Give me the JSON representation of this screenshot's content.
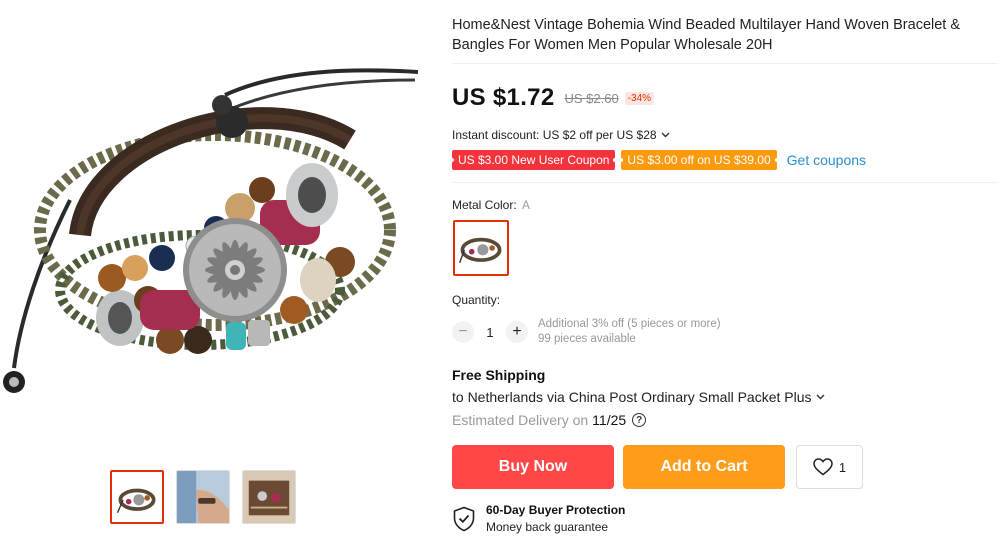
{
  "product": {
    "title": "Home&Nest Vintage Bohemia Wind Beaded Multilayer Hand Woven Bracelet & Bangles For Women Men Popular Wholesale 20H"
  },
  "price": {
    "current": "US $1.72",
    "original": "US $2.60",
    "discount": "-34%"
  },
  "discounts": {
    "instant": "Instant discount: US $2 off per US $28",
    "coupons": [
      "US $3.00 New User Coupon",
      "US $3.00 off on US $39.00"
    ],
    "get_coupons": "Get coupons"
  },
  "sku": {
    "label": "Metal Color:",
    "selected": "A"
  },
  "quantity": {
    "label": "Quantity:",
    "value": "1",
    "decrease": "−",
    "increase": "+",
    "note": "Additional 3% off (5 pieces or more)",
    "available": "99 pieces available"
  },
  "shipping": {
    "title": "Free Shipping",
    "line": "to Netherlands via China Post Ordinary Small Packet Plus",
    "estimated_label": "Estimated Delivery on",
    "date": "11/25",
    "help": "?"
  },
  "actions": {
    "buy_now": "Buy Now",
    "add_to_cart": "Add to Cart",
    "wish_count": "1"
  },
  "protection": {
    "title": "60-Day Buyer Protection",
    "subtitle": "Money back guarantee"
  },
  "icons": {
    "caret": "chevron-down-icon",
    "wish": "heart-icon",
    "protection": "shield-check-icon",
    "help": "question-circle-icon"
  },
  "colors": {
    "buy_now": "#ff4747",
    "add_to_cart": "#ff9c1a",
    "coupon_red": "#f4333c",
    "coupon_orange": "#fc9a0e",
    "link": "#2a8fd3",
    "selected_border": "#e62e04"
  }
}
